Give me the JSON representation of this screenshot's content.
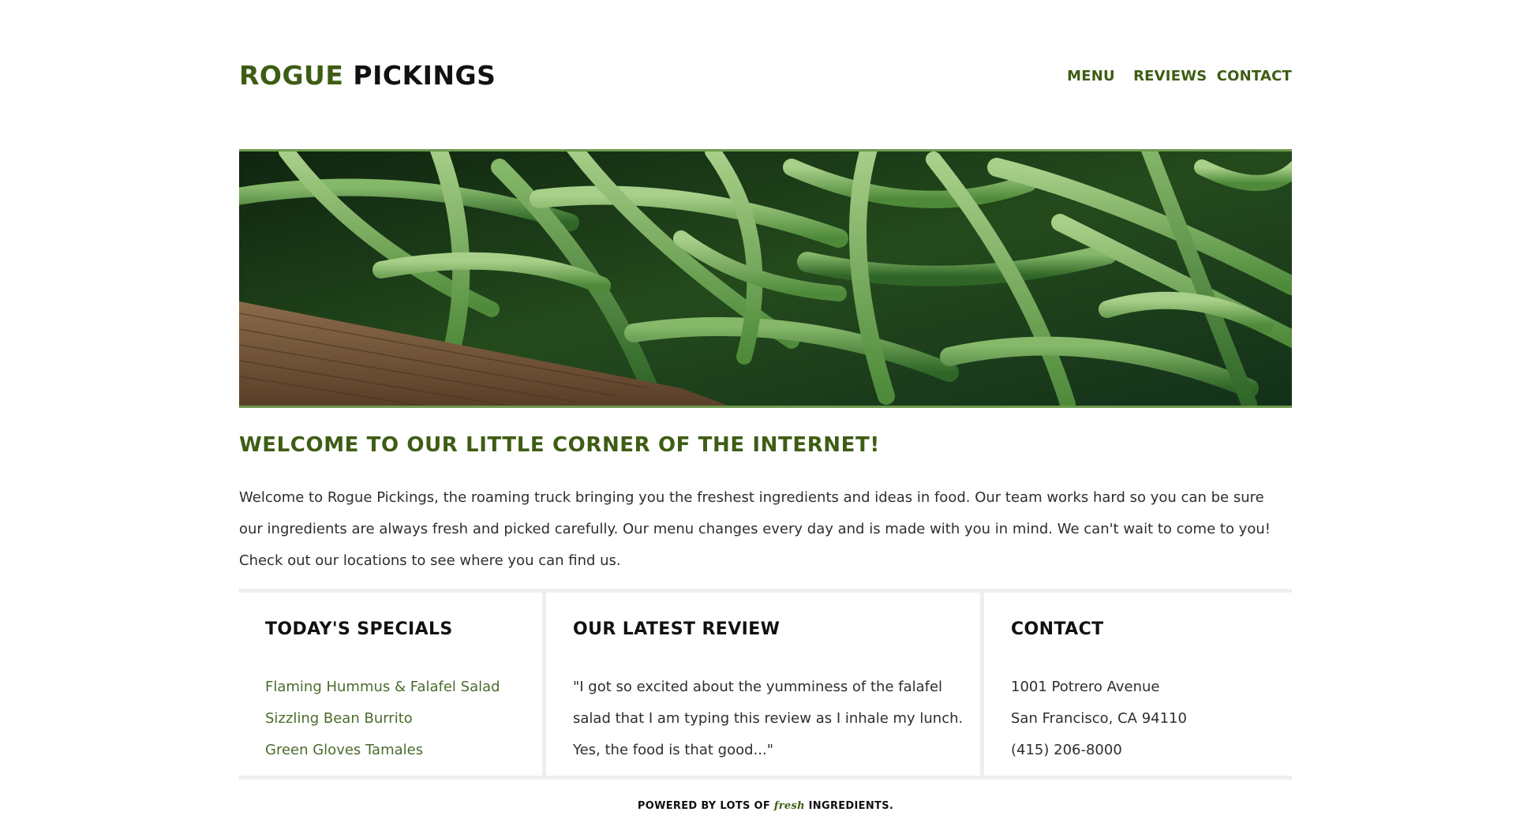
{
  "header": {
    "logo_accent": "ROGUE",
    "logo_rest": "PICKINGS",
    "nav": {
      "menu": "MENU",
      "reviews": "REVIEWS",
      "contact": "CONTACT"
    }
  },
  "hero": {
    "image": "green-beans-crate-photo"
  },
  "welcome": {
    "title": "WELCOME TO OUR LITTLE CORNER OF THE INTERNET!",
    "body": "Welcome to Rogue Pickings, the roaming truck bringing you the freshest ingredients and ideas in food. Our team works hard so you can be sure our ingredients are always fresh and picked carefully. Our menu changes every day and is made with you in mind. We can't wait to come to you! Check out our locations to see where you can find us."
  },
  "specials": {
    "title": "TODAY'S SPECIALS",
    "items": [
      "Flaming Hummus & Falafel Salad",
      "Sizzling Bean Burrito",
      "Green Gloves Tamales"
    ]
  },
  "review": {
    "title": "OUR LATEST REVIEW",
    "text": "\"I got so excited about the yumminess of the falafel salad that I am typing this review as I inhale my lunch. Yes, the food is that good...\""
  },
  "contact": {
    "title": "CONTACT",
    "address": "1001 Potrero Avenue",
    "city": "San Francisco, CA 94110",
    "phone": "(415) 206-8000"
  },
  "footer": {
    "before": "POWERED BY LOTS OF",
    "fresh": "fresh",
    "after": "INGREDIENTS."
  },
  "colors": {
    "brand_green": "#3e5d14",
    "link_green": "#4c6b2e",
    "hero_border": "#6d9a4d",
    "divider": "#eeeeee"
  }
}
